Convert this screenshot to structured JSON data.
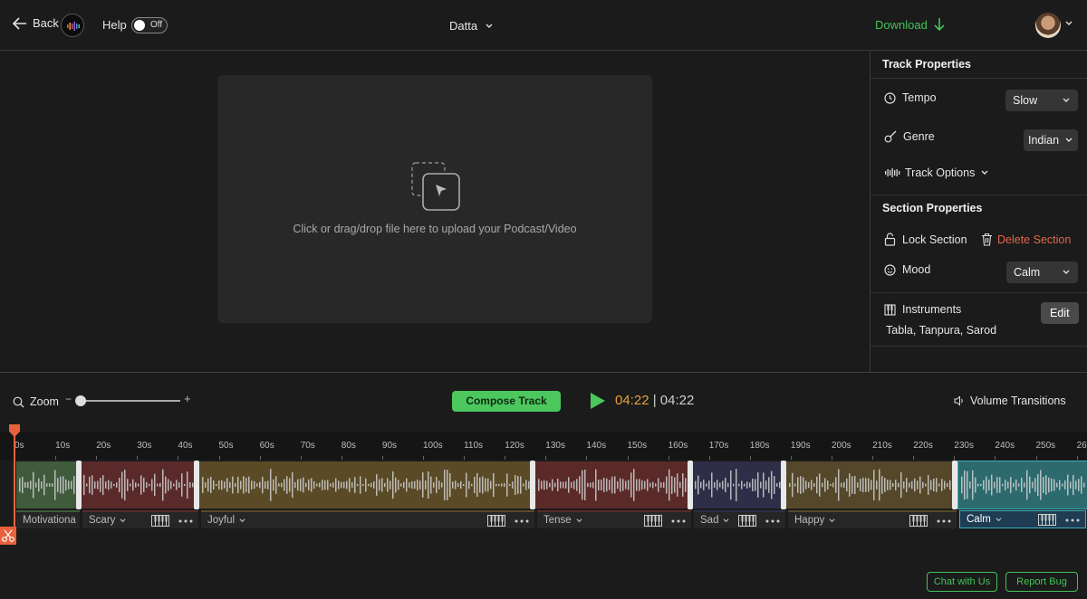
{
  "header": {
    "back_label": "Back",
    "help_label": "Help",
    "help_toggle_state": "Off",
    "project_name": "Datta",
    "download_label": "Download"
  },
  "preview": {
    "upload_text": "Click or drag/drop file here to upload your Podcast/Video"
  },
  "track_properties": {
    "title": "Track Properties",
    "tempo_label": "Tempo",
    "tempo_value": "Slow",
    "genre_label": "Genre",
    "genre_value": "Indian",
    "track_options_label": "Track Options"
  },
  "section_properties": {
    "title": "Section Properties",
    "lock_label": "Lock Section",
    "delete_label": "Delete Section",
    "mood_label": "Mood",
    "mood_value": "Calm",
    "instruments_label": "Instruments",
    "instruments_value": "Tabla, Tanpura, Sarod",
    "edit_label": "Edit"
  },
  "controls": {
    "zoom_label": "Zoom",
    "zoom_minus": "−",
    "zoom_plus": "+",
    "compose_label": "Compose Track",
    "current_time": "04:22",
    "separator": "|",
    "total_time": "04:22",
    "volume_transitions_label": "Volume Transitions"
  },
  "timeline": {
    "ticks": [
      "0s",
      "10s",
      "20s",
      "30s",
      "40s",
      "50s",
      "60s",
      "70s",
      "80s",
      "90s",
      "100s",
      "110s",
      "120s",
      "130s",
      "140s",
      "150s",
      "160s",
      "170s",
      "180s",
      "190s",
      "200s",
      "210s",
      "220s",
      "230s",
      "240s",
      "250s",
      "26"
    ],
    "sections": [
      {
        "mood": "Motivationa",
        "color": "#3f5b3c"
      },
      {
        "mood": "Scary",
        "color": "#5a2a2a"
      },
      {
        "mood": "Joyful",
        "color": "#5a4a26"
      },
      {
        "mood": "Tense",
        "color": "#5a2a28"
      },
      {
        "mood": "Sad",
        "color": "#2e2e48"
      },
      {
        "mood": "Happy",
        "color": "#55482a"
      },
      {
        "mood": "Calm",
        "color": "#2c6a6e"
      }
    ]
  },
  "footer": {
    "chat_label": "Chat with Us",
    "bug_label": "Report Bug"
  },
  "colors": {
    "accent_green": "#4cc75e",
    "accent_orange": "#e6a23c",
    "delete_red": "#e0664a",
    "playhead": "#e8613c"
  }
}
